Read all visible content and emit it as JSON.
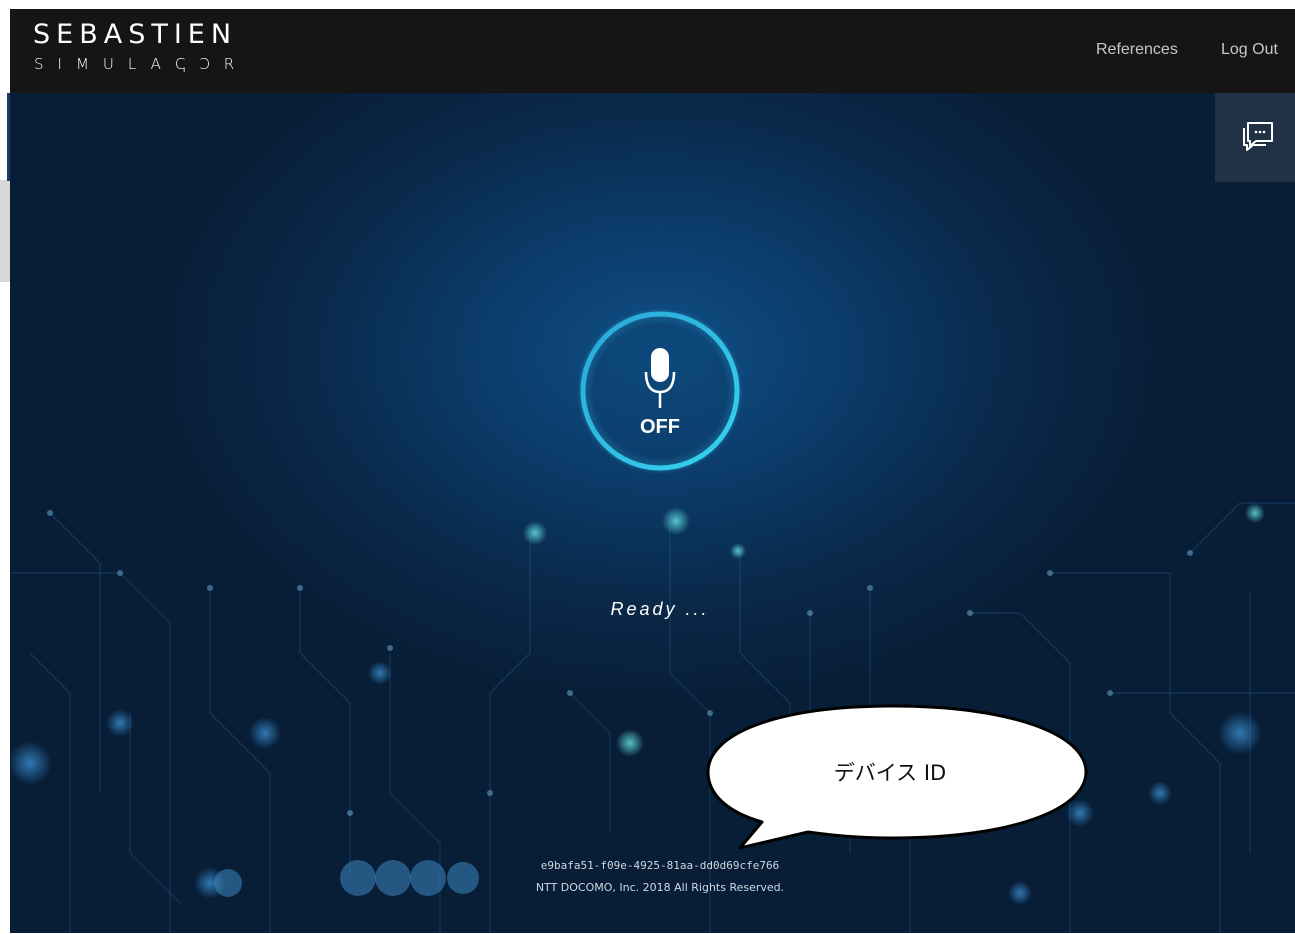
{
  "header": {
    "logo_main": "SEBASTIEN",
    "logo_sub": "SIMULAↅↃR",
    "nav": [
      {
        "label": "References"
      },
      {
        "label": "Log Out"
      }
    ]
  },
  "mic": {
    "state_label": "OFF",
    "icon": "microphone-icon"
  },
  "chat": {
    "icon": "chat-bubble-icon"
  },
  "status": {
    "text": "Ready ..."
  },
  "footer": {
    "device_id": "e9bafa51-f09e-4925-81aa-dd0d69cfe766",
    "copyright": "NTT DOCOMO, Inc. 2018 All Rights Reserved."
  },
  "annotation": {
    "callout_text": "デバイス ID"
  },
  "colors": {
    "topbar": "#151515",
    "background": "#0b1d36",
    "accent": "#2fc6e6"
  }
}
